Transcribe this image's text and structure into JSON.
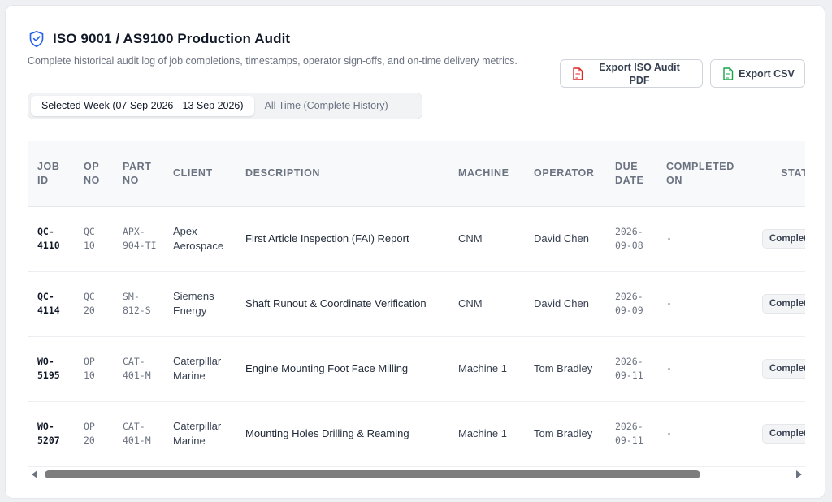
{
  "header": {
    "title": "ISO 9001 / AS9100 Production Audit",
    "subtitle": "Complete historical audit log of job completions, timestamps, operator sign-offs, and on-time delivery metrics.",
    "accent_color": "#2563eb"
  },
  "actions": {
    "export_pdf_label": "Export ISO Audit PDF",
    "export_csv_label": "Export CSV",
    "pdf_icon_color": "#dc2626",
    "csv_icon_color": "#16a34a"
  },
  "tabs": [
    {
      "label": "Selected Week (07 Sep 2026 - 13 Sep 2026)",
      "active": true
    },
    {
      "label": "All Time (Complete History)",
      "active": false
    }
  ],
  "table": {
    "columns": [
      "JOB ID",
      "OP NO",
      "PART NO",
      "CLIENT",
      "DESCRIPTION",
      "MACHINE",
      "OPERATOR",
      "DUE DATE",
      "COMPLETED ON",
      "STATUS"
    ],
    "rows": [
      {
        "job_id": "QC-4110",
        "op_no": "QC 10",
        "part_no": "APX-904-TI",
        "client": "Apex Aerospace",
        "description": "First Article Inspection (FAI) Report",
        "machine": "CNM",
        "operator": "David Chen",
        "due_date": "2026-09-08",
        "completed_on": "-",
        "status": "Completed"
      },
      {
        "job_id": "QC-4114",
        "op_no": "QC 20",
        "part_no": "SM-812-S",
        "client": "Siemens Energy",
        "description": "Shaft Runout & Coordinate Verification",
        "machine": "CNM",
        "operator": "David Chen",
        "due_date": "2026-09-09",
        "completed_on": "-",
        "status": "Completed"
      },
      {
        "job_id": "WO-5195",
        "op_no": "OP 10",
        "part_no": "CAT-401-M",
        "client": "Caterpillar Marine",
        "description": "Engine Mounting Foot Face Milling",
        "machine": "Machine 1",
        "operator": "Tom Bradley",
        "due_date": "2026-09-11",
        "completed_on": "-",
        "status": "Completed"
      },
      {
        "job_id": "WO-5207",
        "op_no": "OP 20",
        "part_no": "CAT-401-M",
        "client": "Caterpillar Marine",
        "description": "Mounting Holes Drilling & Reaming",
        "machine": "Machine 1",
        "operator": "Tom Bradley",
        "due_date": "2026-09-11",
        "completed_on": "-",
        "status": "Completed"
      }
    ]
  }
}
